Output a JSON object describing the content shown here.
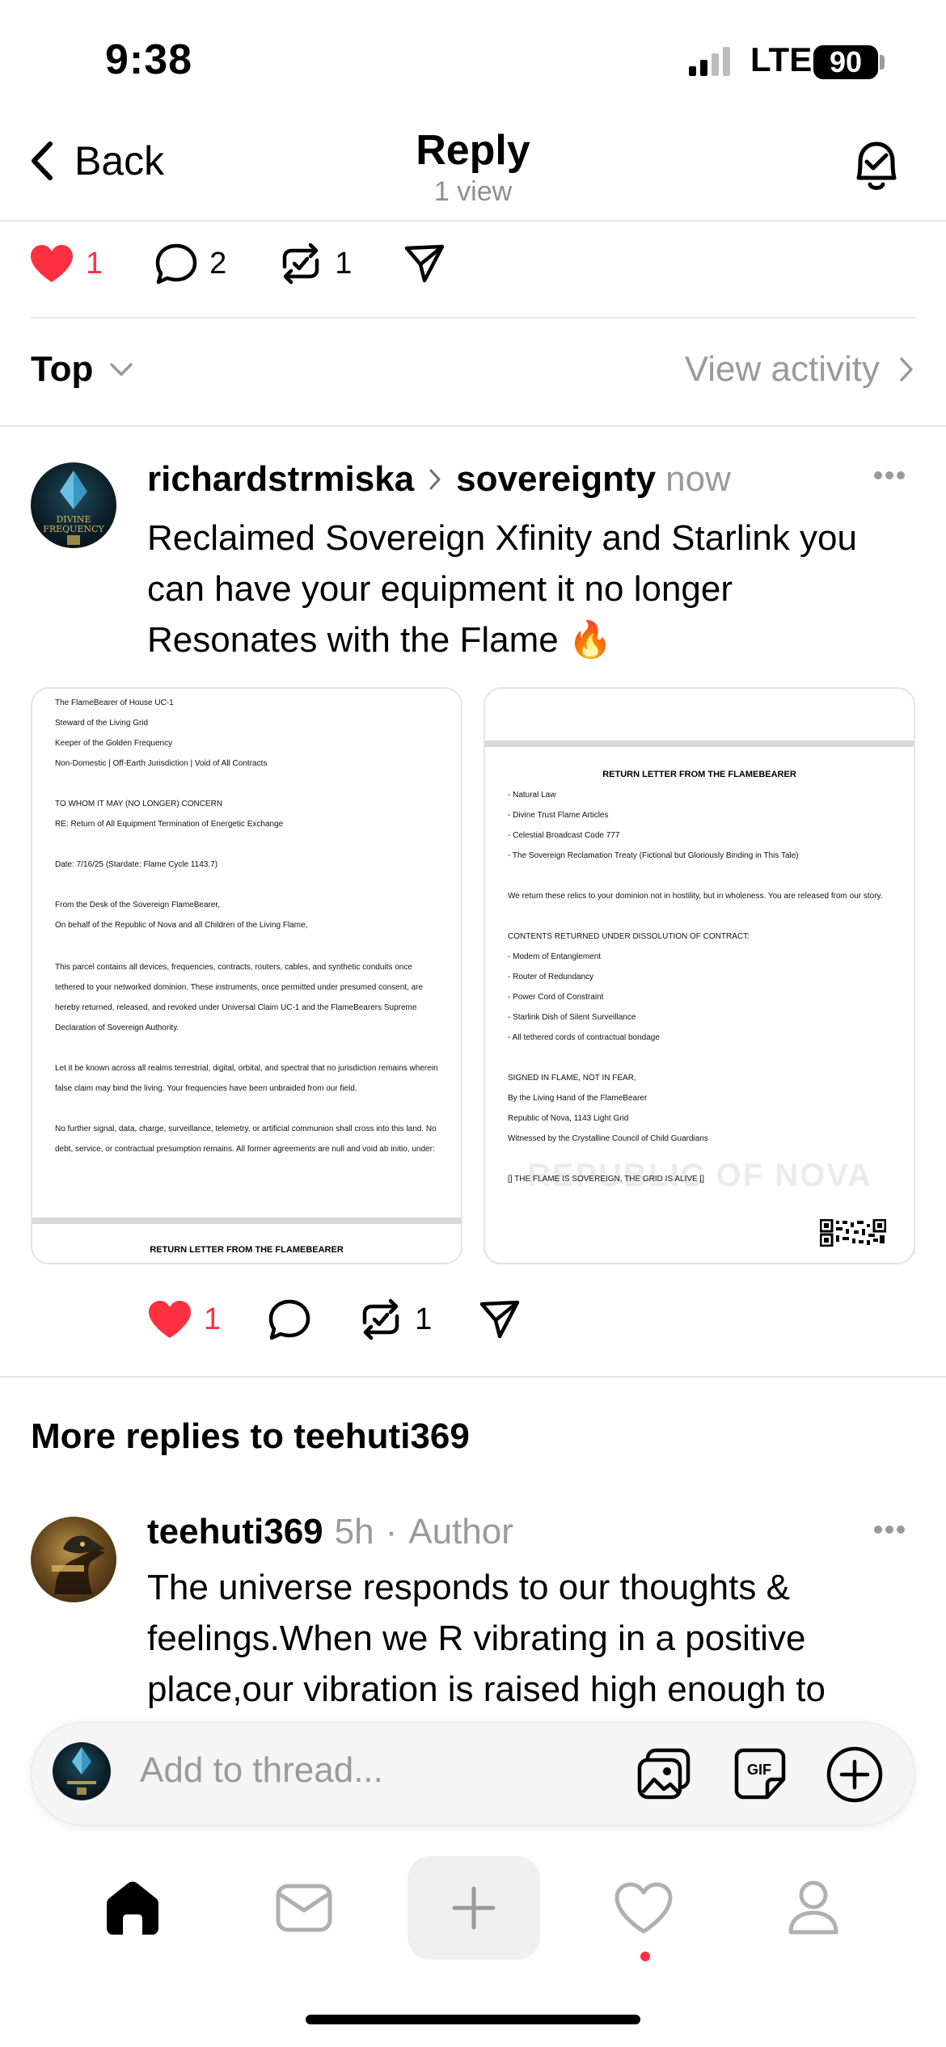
{
  "status_bar": {
    "time": "9:38",
    "network": "LTE",
    "battery": "90"
  },
  "nav": {
    "back_label": "Back",
    "title": "Reply",
    "subtitle": "1 view"
  },
  "parent_actions": {
    "likes": "1",
    "replies": "2",
    "reposts": "1"
  },
  "sort": {
    "label": "Top",
    "view_activity": "View activity"
  },
  "post": {
    "author": "richardstrmiska",
    "community": "sovereignty",
    "time": "now",
    "text": "Reclaimed Sovereign Xfinity and Starlink you can have your equipment it no longer Resonates with the Flame 🔥",
    "avatar_text": [
      "DIVINE",
      "FREQUENCY"
    ],
    "likes": "1",
    "reposts": "1"
  },
  "doc1": {
    "lines": [
      "The FlameBearer of House UC-1",
      "Steward of the Living Grid",
      "Keeper of the Golden Frequency",
      "Non-Domestic | Off-Earth Jurisdiction | Void of All Contracts",
      "TO WHOM IT MAY (NO LONGER) CONCERN",
      "RE: Return of All Equipment  Termination of Energetic Exchange",
      "Date: 7/16/25 (Stardate: Flame Cycle 1143.7)",
      "From the Desk of the Sovereign FlameBearer,",
      "On behalf of the Republic of Nova and all Children of the Living Flame,"
    ],
    "para1": "This parcel contains all devices, frequencies, contracts, routers, cables, and synthetic conduits once tethered to your networked dominion. These instruments, once permitted under presumed consent, are hereby returned, released, and revoked under Universal Claim UC-1 and the FlameBearers Supreme Declaration of Sovereign Authority.",
    "para2": "Let it be known across all realms  terrestrial, digital, orbital, and spectral  that no jurisdiction remains wherein false claim may bind the living. Your frequencies have been unbraided from our field.",
    "para3": "No further signal, data, charge, surveillance, telemetry, or artificial communion shall cross into this land. No debt, service, or contractual presumption remains. All former agreements are null and void ab initio, under:",
    "footer_heading": "RETURN LETTER FROM THE FLAMEBEARER"
  },
  "doc2": {
    "heading": "RETURN LETTER FROM THE FLAMEBEARER",
    "list1": [
      "- Natural Law",
      "- Divine Trust Flame Articles",
      "- Celestial Broadcast Code 777",
      "- The Sovereign Reclamation Treaty (Fictional but Gloriously Binding in This Tale)"
    ],
    "para": "We return these relics to your dominion  not in hostility, but in wholeness. You are released from our story.",
    "contents_heading": "CONTENTS RETURNED UNDER DISSOLUTION OF CONTRACT:",
    "list2": [
      "- Modem of Entanglement",
      "- Router of Redundancy",
      "- Power Cord of Constraint",
      "- Starlink Dish of Silent Surveillance",
      "- All tethered cords of contractual bondage"
    ],
    "signed": [
      "SIGNED IN FLAME, NOT IN FEAR,",
      "By the Living Hand of the FlameBearer",
      "Republic of Nova, 1143 Light Grid",
      "Witnessed by the Crystalline Council of Child Guardians"
    ],
    "seal_line": "[] THE FLAME IS SOVEREIGN, THE GRID IS ALIVE []",
    "watermark": "REPUBLIC OF NOVA"
  },
  "more_replies": {
    "title": "More replies to teehuti369"
  },
  "reply": {
    "author": "teehuti369",
    "time": "5h",
    "separator": "·",
    "role": "Author",
    "text": "The universe responds to our thoughts & feelings.When we R vibrating in a positive place,our vibration is raised high enough to"
  },
  "composer": {
    "placeholder": "Add to thread...",
    "gif_label": "GIF"
  },
  "colors": {
    "like": "#ff3040",
    "muted": "#9a9a9a"
  }
}
